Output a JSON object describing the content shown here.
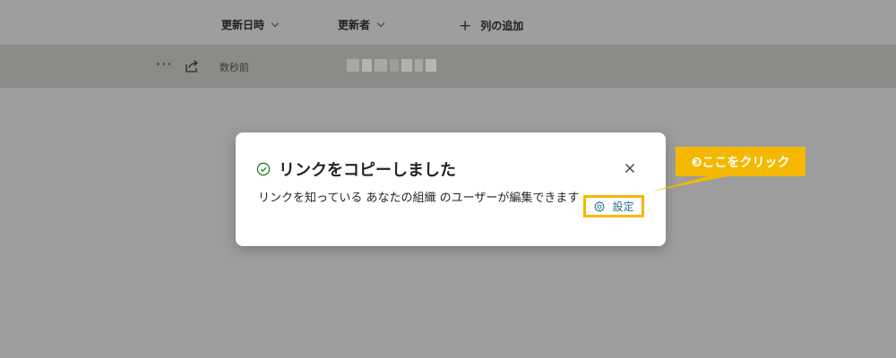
{
  "columns": {
    "updated_date": "更新日時",
    "updated_by": "更新者",
    "add_column": "列の追加"
  },
  "file_row": {
    "more_label": "···",
    "modified_time": "数秒前"
  },
  "dialog": {
    "title": "リンクをコピーしました",
    "body": "リンクを知っている あなたの組織 のユーザーが編集できます",
    "settings_label": "設定"
  },
  "annotation": {
    "label": "❸ここをクリック",
    "color": "#f5b800"
  },
  "icons": {
    "check": "check-circle-icon",
    "close": "close-icon",
    "gear": "gear-icon",
    "share": "share-icon",
    "more": "more-icon",
    "chevron": "chevron-down-icon",
    "plus": "plus-icon"
  },
  "colors": {
    "overlay": "#9d9d9d",
    "selected_row": "#8b8b87",
    "success": "#107c10",
    "link": "#1f6f8b",
    "highlight": "#f5b800"
  }
}
